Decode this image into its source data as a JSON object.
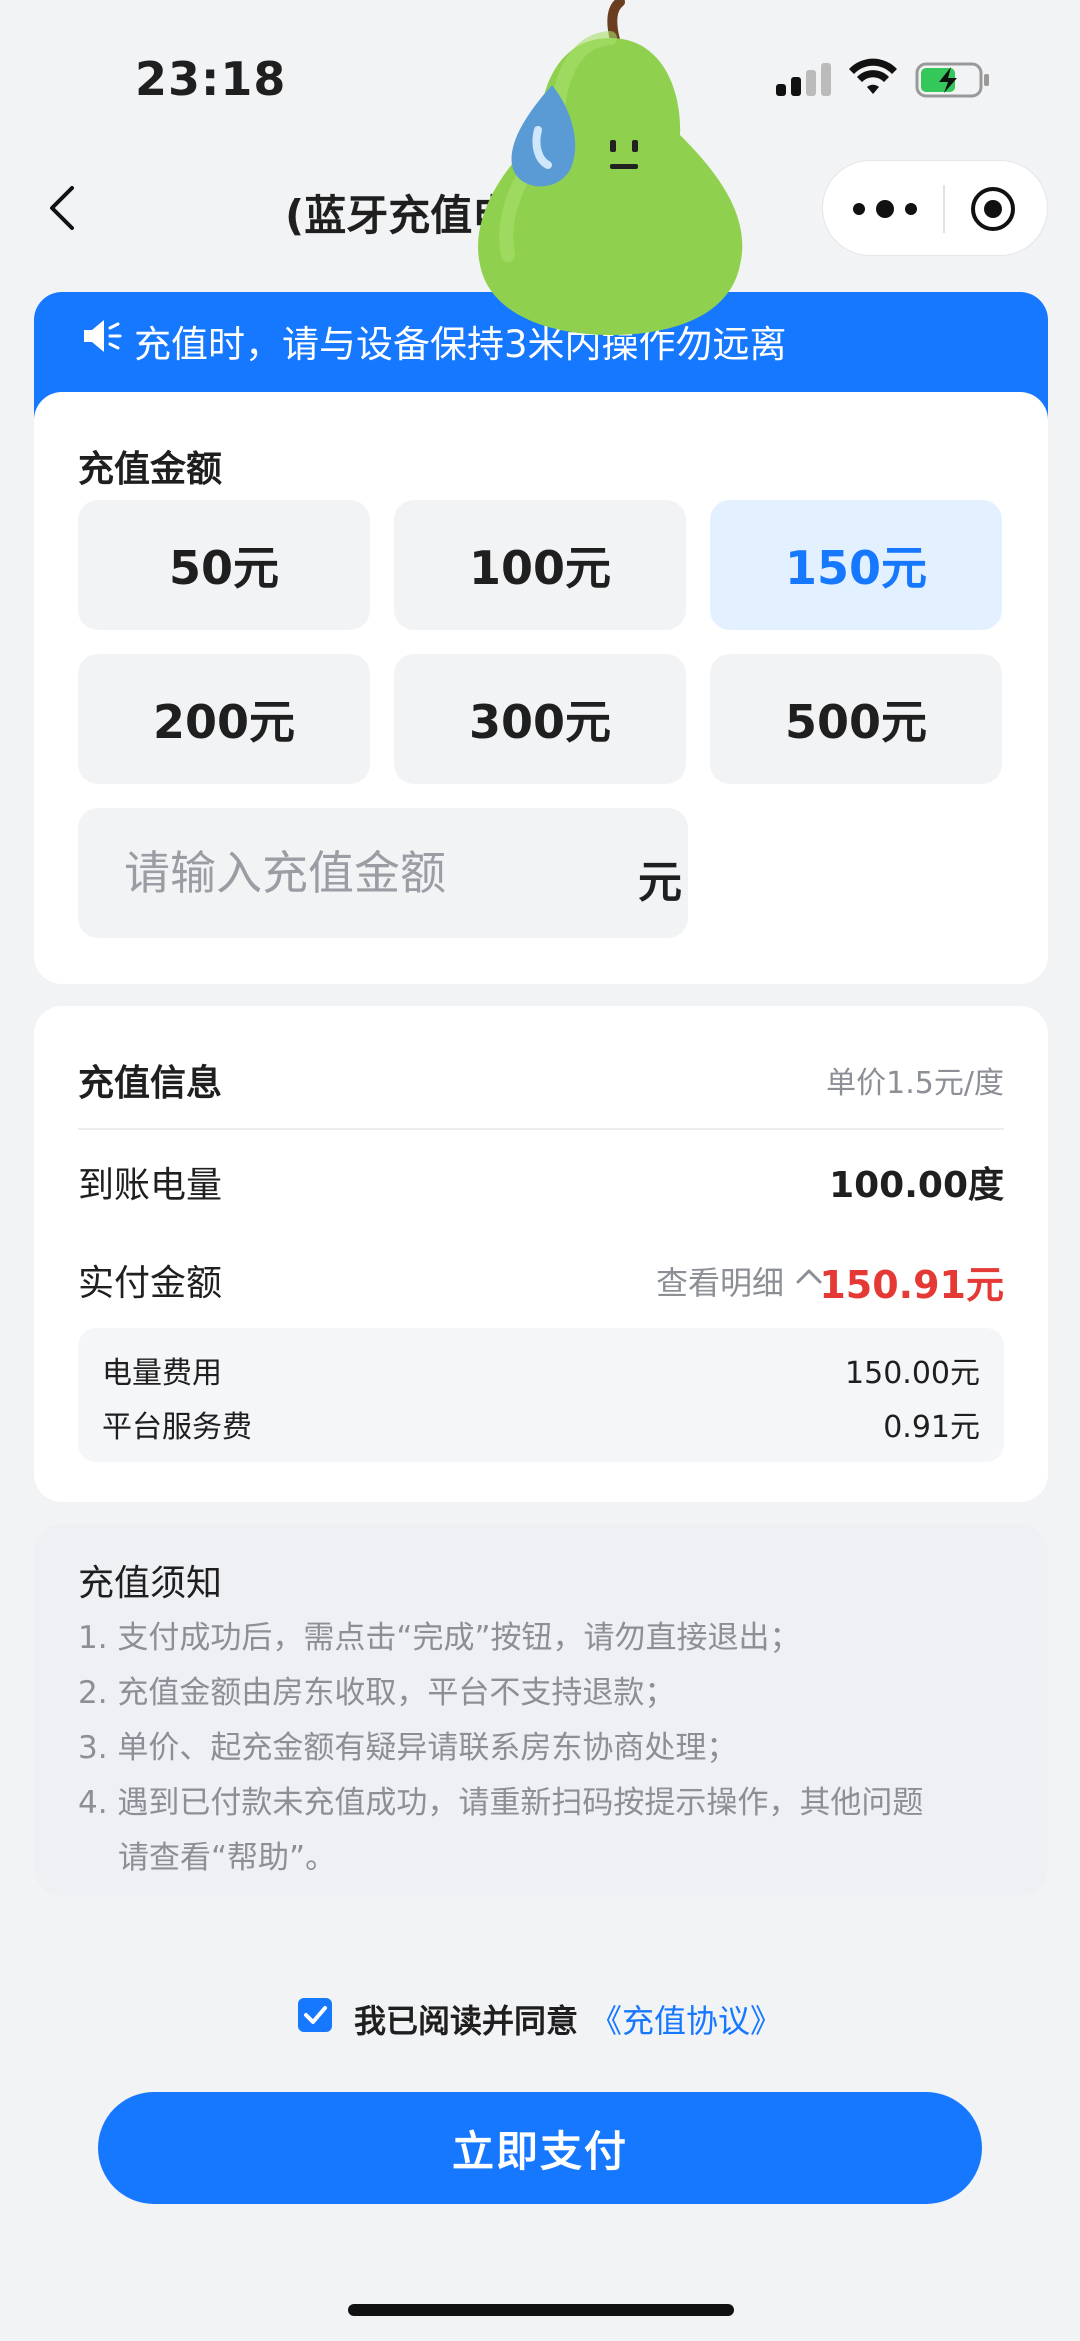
{
  "status_bar": {
    "time": "23:18"
  },
  "nav": {
    "title": "(蓝牙充值电表)…"
  },
  "banner": {
    "text": "充值时，请与设备保持3米内操作勿远离"
  },
  "amount": {
    "title": "充值金额",
    "options": [
      "50元",
      "100元",
      "150元",
      "200元",
      "300元",
      "500元"
    ],
    "selected": "150元",
    "input_placeholder": "请输入充值金额",
    "input_unit": "元"
  },
  "info": {
    "title": "充值信息",
    "unit_price": "单价1.5元/度",
    "energy_label": "到账电量",
    "energy_value": "100.00度",
    "paid_label": "实付金额",
    "detail_link": "查看明细",
    "paid_value": "150.91元",
    "breakdown": [
      {
        "label": "电量费用",
        "value": "150.00元"
      },
      {
        "label": "平台服务费",
        "value": "0.91元"
      }
    ]
  },
  "notes": {
    "title": "充值须知",
    "lines": [
      "1. 支付成功后，需点击“完成”按钮，请勿直接退出；",
      "2. 充值金额由房东收取，平台不支持退款；",
      "3. 单价、起充金额有疑异请联系房东协商处理；",
      "4. 遇到已付款未充值成功，请重新扫码按提示操作，其他问题",
      "请查看“帮助”。"
    ]
  },
  "agreement": {
    "text": "我已阅读并同意",
    "link": "《充值协议》",
    "checked": true
  },
  "pay_button": {
    "label": "立即支付"
  },
  "colors": {
    "accent": "#1677ff",
    "price": "#e53935",
    "background": "#f2f3f5"
  }
}
